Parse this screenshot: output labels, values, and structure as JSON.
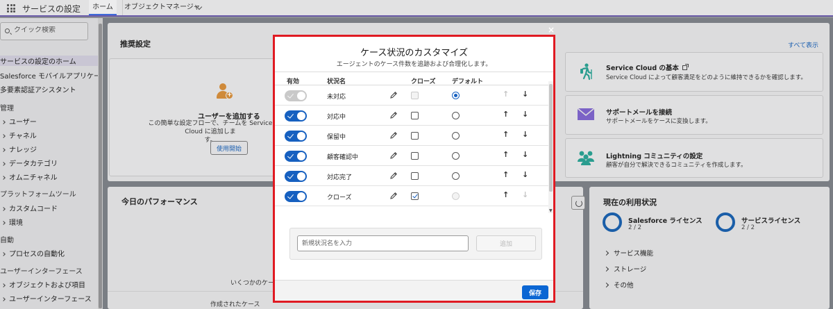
{
  "header": {
    "app_title": "サービスの設定",
    "tabs": [
      {
        "label": "ホーム"
      },
      {
        "label": "オブジェクトマネージャー"
      }
    ]
  },
  "sidebar": {
    "search_placeholder": "クイック検索",
    "items": [
      {
        "label": "サービスの設定のホーム"
      },
      {
        "label": "Salesforce モバイルアプリケーション"
      },
      {
        "label": "多要素認証アシスタント"
      },
      {
        "label": "管理"
      },
      {
        "label": "ユーザー"
      },
      {
        "label": "チャネル"
      },
      {
        "label": "ナレッジ"
      },
      {
        "label": "データカテゴリ"
      },
      {
        "label": "オムニチャネル"
      },
      {
        "label": "プラットフォームツール"
      },
      {
        "label": "カスタムコード"
      },
      {
        "label": "環境"
      },
      {
        "label": "自動"
      },
      {
        "label": "プロセスの自動化"
      },
      {
        "label": "ユーザーインターフェース"
      },
      {
        "label": "オブジェクトおよび項目"
      },
      {
        "label": "ユーザーインターフェース"
      }
    ]
  },
  "recommended": {
    "title": "推奨設定",
    "see_all": "すべて表示",
    "add_user": {
      "title": "ユーザーを追加する",
      "desc": "この簡単な設定フローで、チームを Service Cloud に追加しま",
      "desc2": "す。",
      "button": "使用開始"
    },
    "cards": [
      {
        "title": "Service Cloud の基本",
        "desc": "Service Cloud によって顧客満足をどのように維持できるかを確認します。"
      },
      {
        "title": "サポートメールを接続",
        "desc": "サポートメールをケースに変換します。"
      },
      {
        "title": "Lightning コミュニティの設定",
        "desc": "顧客が自分で解決できるコミュニティを作成します。"
      }
    ]
  },
  "performance": {
    "title": "今日のパフォーマンス",
    "few_cases": "いくつかのケース",
    "created_cases": "作成されたケース"
  },
  "usage": {
    "title": "現在の利用状況",
    "licenses": [
      {
        "name": "Salesforce ライセンス",
        "count": "2 / 2"
      },
      {
        "name": "サービスライセンス",
        "count": "2 / 2"
      }
    ],
    "sections": [
      {
        "label": "サービス機能"
      },
      {
        "label": "ストレージ"
      },
      {
        "label": "その他"
      }
    ]
  },
  "modal": {
    "close": "×",
    "title": "ケース状況のカスタマイズ",
    "subtitle": "エージェントのケース件数を追跡および合理化します。",
    "headers": {
      "active": "有効",
      "name": "状況名",
      "closed": "クローズ",
      "default": "デフォルト"
    },
    "rows": [
      {
        "name": "未対応",
        "active": true,
        "active_disabled": true,
        "closed": false,
        "closed_disabled": true,
        "is_default": true,
        "up_disabled": true,
        "down_disabled": false
      },
      {
        "name": "対応中",
        "active": true,
        "active_disabled": false,
        "closed": false,
        "closed_disabled": false,
        "is_default": false,
        "up_disabled": false,
        "down_disabled": false
      },
      {
        "name": "保留中",
        "active": true,
        "active_disabled": false,
        "closed": false,
        "closed_disabled": false,
        "is_default": false,
        "up_disabled": false,
        "down_disabled": false
      },
      {
        "name": "顧客確認中",
        "active": true,
        "active_disabled": false,
        "closed": false,
        "closed_disabled": false,
        "is_default": false,
        "up_disabled": false,
        "down_disabled": false
      },
      {
        "name": "対応完了",
        "active": true,
        "active_disabled": false,
        "closed": false,
        "closed_disabled": false,
        "is_default": false,
        "up_disabled": false,
        "down_disabled": false
      },
      {
        "name": "クローズ",
        "active": true,
        "active_disabled": false,
        "closed": true,
        "closed_disabled": false,
        "is_default": false,
        "default_disabled": true,
        "up_disabled": false,
        "down_disabled": true
      }
    ],
    "new_status_placeholder": "新規状況名を入力",
    "add_button": "追加",
    "save_button": "保存"
  },
  "colors": {
    "accent": "#0b66d3",
    "highlight_border": "#e01a22",
    "add_user_icon": "#cf8a3a",
    "card_icon": "#2a9d8f"
  }
}
